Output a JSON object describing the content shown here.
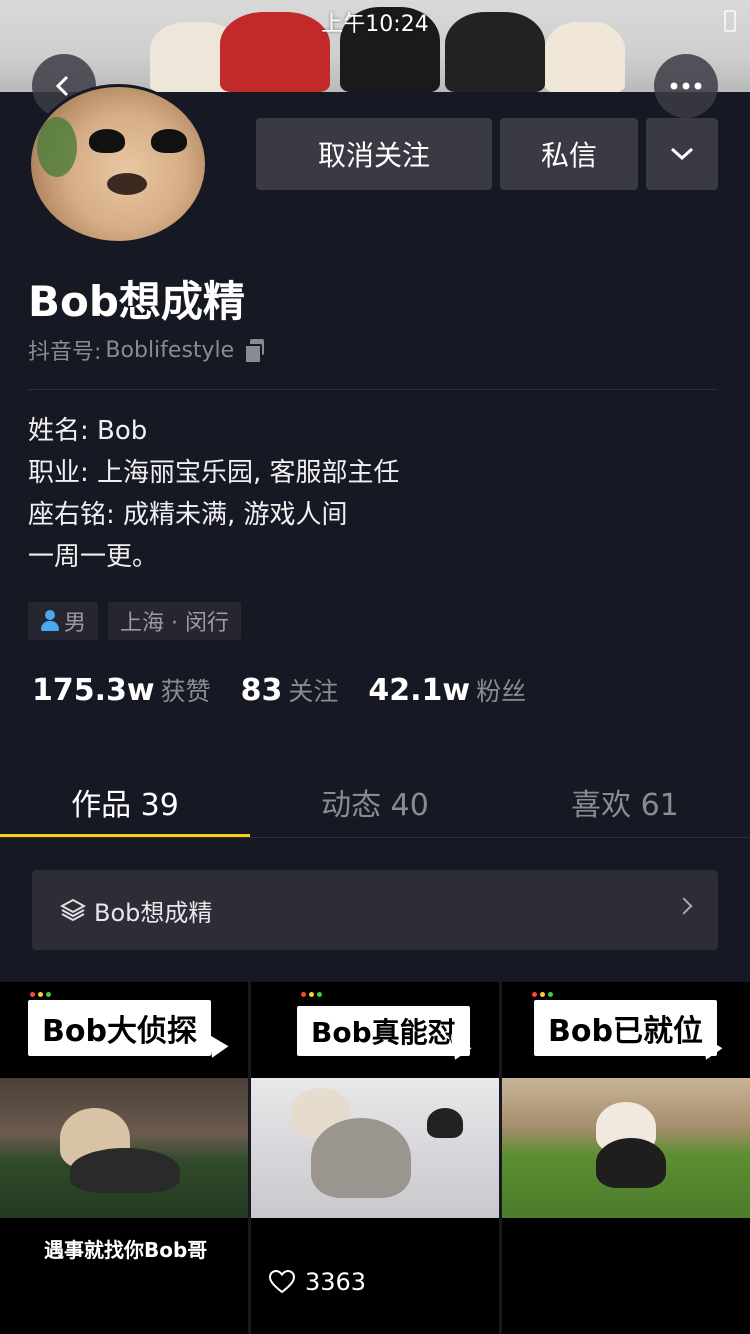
{
  "status_bar": {
    "time": "上午10:24"
  },
  "profile": {
    "name": "Bob想成精",
    "douyin_id_label": "抖音号:",
    "douyin_id": "Boblifestyle",
    "bio_lines": [
      "姓名: Bob",
      "职业: 上海丽宝乐园, 客服部主任",
      "座右铭: 成精未满, 游戏人间",
      "一周一更。"
    ],
    "tags": {
      "gender": "男",
      "location": "上海 · 闵行"
    }
  },
  "actions": {
    "unfollow": "取消关注",
    "message": "私信"
  },
  "stats": [
    {
      "value": "175.3w",
      "label": "获赞"
    },
    {
      "value": "83",
      "label": "关注"
    },
    {
      "value": "42.1w",
      "label": "粉丝"
    }
  ],
  "tabs": [
    {
      "label": "作品 39",
      "active": true
    },
    {
      "label": "动态 40",
      "active": false
    },
    {
      "label": "喜欢 61",
      "active": false
    }
  ],
  "collection": {
    "label": "Bob想成精"
  },
  "videos": [
    {
      "title": "Bob大侦探",
      "caption": "遇事就找你Bob哥",
      "likes": ""
    },
    {
      "title": "Bob真能怼",
      "caption": "",
      "likes": "3363"
    },
    {
      "title": "Bob已就位",
      "caption": "",
      "likes": ""
    }
  ],
  "colors": {
    "background": "#161823",
    "accent": "#face15",
    "button": "#3a3a44"
  }
}
